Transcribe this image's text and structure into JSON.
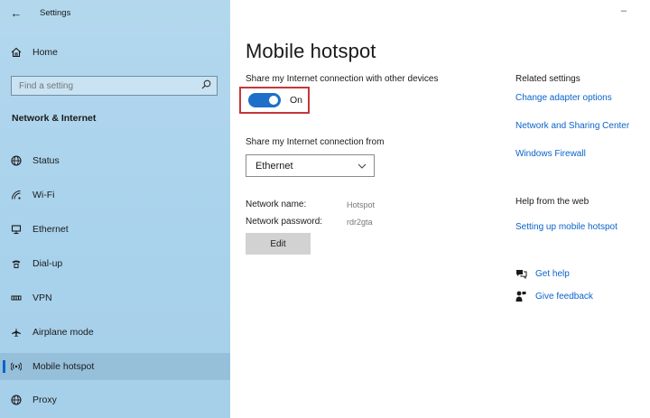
{
  "window": {
    "title": "Settings",
    "minimize_glyph": "–"
  },
  "sidebar": {
    "home_label": "Home",
    "search_placeholder": "Find a setting",
    "section_title": "Network & Internet",
    "items": [
      {
        "label": "Status",
        "icon": "globe-icon"
      },
      {
        "label": "Wi-Fi",
        "icon": "wifi-icon"
      },
      {
        "label": "Ethernet",
        "icon": "ethernet-icon"
      },
      {
        "label": "Dial-up",
        "icon": "phone-icon"
      },
      {
        "label": "VPN",
        "icon": "vpn-icon"
      },
      {
        "label": "Airplane mode",
        "icon": "airplane-icon"
      },
      {
        "label": "Mobile hotspot",
        "icon": "hotspot-icon",
        "active": true
      },
      {
        "label": "Proxy",
        "icon": "globe-icon"
      }
    ]
  },
  "main": {
    "page_title": "Mobile hotspot",
    "share_label": "Share my Internet connection with other devices",
    "toggle": {
      "state": "On",
      "on": true
    },
    "share_from_label": "Share my Internet connection from",
    "share_from_value": "Ethernet",
    "network_name_label": "Network name:",
    "network_name_value": "Hotspot",
    "network_password_label": "Network password:",
    "network_password_value": "rdr2gta",
    "edit_label": "Edit"
  },
  "related": {
    "heading": "Related settings",
    "links": [
      "Change adapter options",
      "Network and Sharing Center",
      "Windows Firewall"
    ]
  },
  "help": {
    "heading": "Help from the web",
    "link": "Setting up mobile hotspot",
    "get_help": "Get help",
    "feedback": "Give feedback"
  },
  "colors": {
    "accent": "#0a63c9",
    "toggle_on": "#1e6fc9",
    "highlight_border": "#c5373a",
    "sidebar_bg": "#a9d2ec"
  }
}
